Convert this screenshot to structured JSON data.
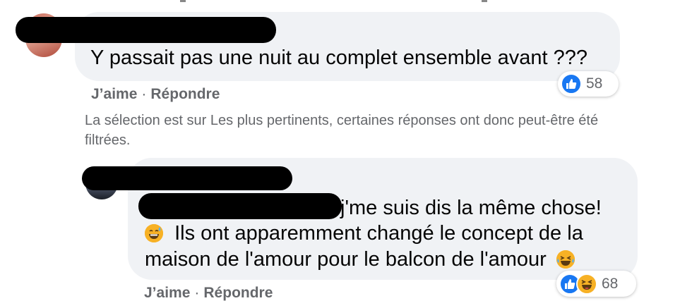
{
  "comment1": {
    "text": "Y passait pas une nuit au complet ensemble avant ???",
    "actions": {
      "like": "J’aime",
      "separator": "·",
      "reply": "Répondre"
    },
    "reactions": {
      "count": "58",
      "icons": [
        "like-icon"
      ]
    }
  },
  "filter_note": "La sélection est sur Les plus pertinents, certaines réponses ont donc peut-être été filtrées.",
  "reply1": {
    "line1": "j'me suis dis la même chose!",
    "line2": "Ils ont apparemment changé le concept de la",
    "line3": "maison de l'amour pour le balcon de l'amour",
    "actions": {
      "like": "J’aime",
      "separator": "·",
      "reply": "Répondre"
    },
    "reactions": {
      "count": "68",
      "icons": [
        "like-icon",
        "haha-icon"
      ]
    }
  },
  "colors": {
    "bubble": "#f0f2f5",
    "secondary_text": "#65676b",
    "like_blue": "#1877f2",
    "haha_yellow": "#f7b125",
    "redaction": "#000000"
  }
}
